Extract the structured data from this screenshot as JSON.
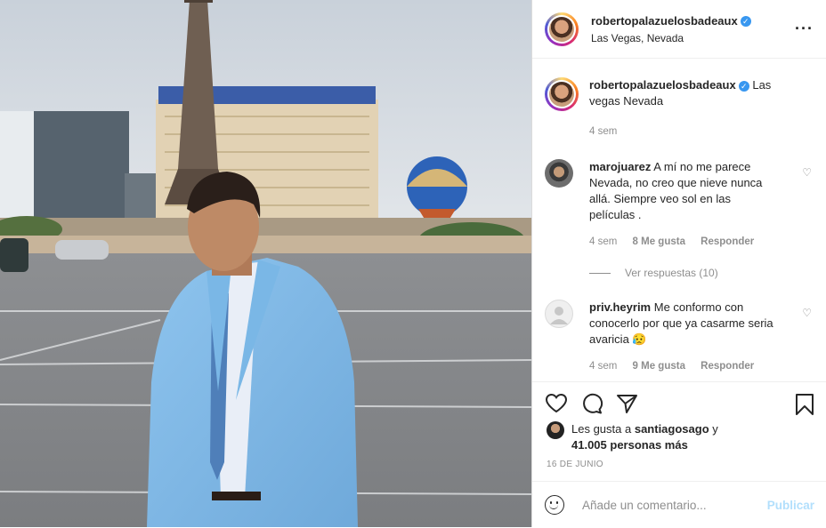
{
  "header": {
    "username": "robertopalazuelosbadeaux",
    "location": "Las Vegas, Nevada",
    "more_icon": "more-horizontal-icon"
  },
  "caption": {
    "username": "robertopalazuelosbadeaux",
    "text": "Las vegas Nevada",
    "time": "4 sem"
  },
  "comments": [
    {
      "username": "marojuarez",
      "text": "A mí no me parece Nevada, no creo que nieve nunca allá. Siempre veo sol en las películas .",
      "time": "4 sem",
      "likes": "8 Me gusta",
      "reply": "Responder"
    },
    {
      "username": "priv.heyrim",
      "text": "Me conformo con conocerlo por que ya casarme seria avaricia 😥",
      "time": "4 sem",
      "likes": "9 Me gusta",
      "reply": "Responder"
    }
  ],
  "view_replies": "Ver respuestas (10)",
  "likes": {
    "line1": "Les gusta a",
    "user": "santiagosago",
    "line2": "y",
    "count": "41.005 personas más"
  },
  "date": "16 DE JUNIO",
  "add_comment": {
    "placeholder": "Añade un comentario...",
    "post_label": "Publicar"
  },
  "icons": [
    "heart-icon",
    "comment-icon",
    "share-icon",
    "bookmark-icon",
    "emoji-icon"
  ]
}
